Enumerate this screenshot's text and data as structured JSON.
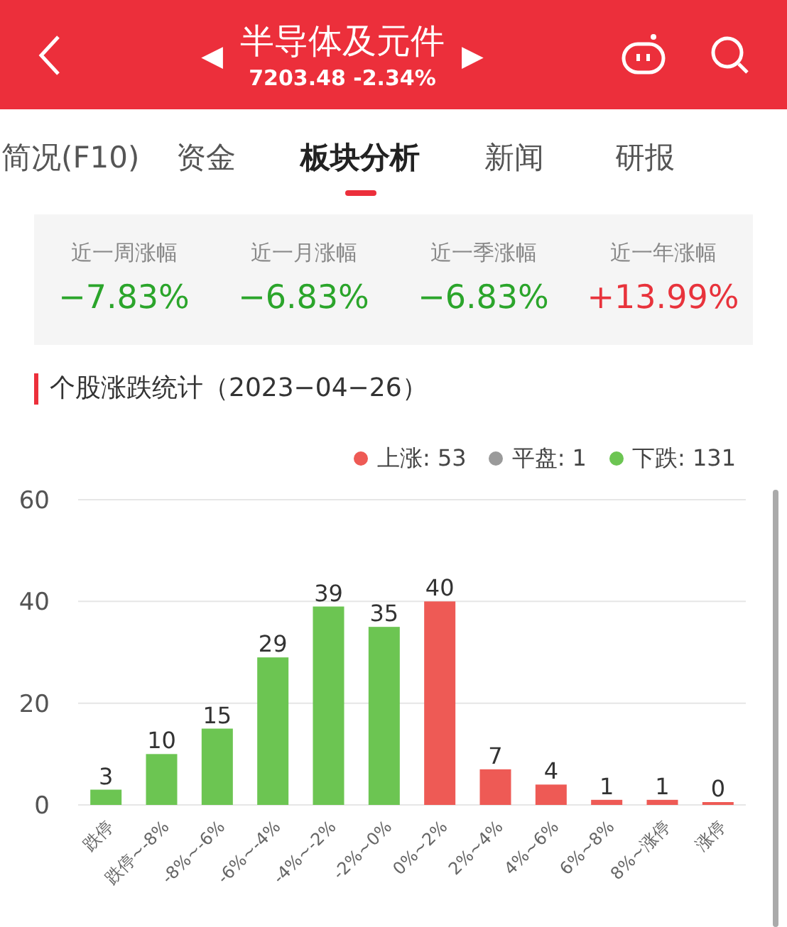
{
  "header": {
    "title": "半导体及元件",
    "quote": "7203.48 -2.34%",
    "prev": "◀",
    "next": "▶"
  },
  "tabs": [
    {
      "label": "简况(F10)",
      "selected": false
    },
    {
      "label": "资金",
      "selected": false
    },
    {
      "label": "板块分析",
      "selected": true
    },
    {
      "label": "新闻",
      "selected": false
    },
    {
      "label": "研报",
      "selected": false
    }
  ],
  "stats": [
    {
      "label": "近一周涨幅",
      "value": "−7.83%",
      "color": "#2ba52b"
    },
    {
      "label": "近一月涨幅",
      "value": "−6.83%",
      "color": "#2ba52b"
    },
    {
      "label": "近一季涨幅",
      "value": "−6.83%",
      "color": "#2ba52b"
    },
    {
      "label": "近一年涨幅",
      "value": "+13.99%",
      "color": "#e8333c"
    }
  ],
  "section_title": "个股涨跌统计（2023−04−26）",
  "legend": [
    {
      "label": "上涨: 53",
      "color": "#ee5a55"
    },
    {
      "label": "平盘: 1",
      "color": "#9a9a9a"
    },
    {
      "label": "下跌: 131",
      "color": "#6cc552"
    }
  ],
  "chart_data": {
    "type": "bar",
    "data_labels": true,
    "categories": [
      "跌停",
      "跌停~-8%",
      "-8%~-6%",
      "-6%~-4%",
      "-4%~-2%",
      "-2%~0%",
      "0%~2%",
      "2%~4%",
      "4%~6%",
      "6%~8%",
      "8%~涨停",
      "涨停"
    ],
    "ylim": [
      0,
      60
    ],
    "yticks": [
      0,
      20,
      40,
      60
    ],
    "series": [
      {
        "color": "#6cc552",
        "values": [
          3,
          10,
          15,
          29,
          39,
          35,
          null,
          null,
          null,
          null,
          null,
          null
        ]
      },
      {
        "color": "#ee5a55",
        "values": [
          null,
          null,
          null,
          null,
          null,
          null,
          40,
          7,
          4,
          1,
          1,
          0
        ]
      }
    ]
  }
}
